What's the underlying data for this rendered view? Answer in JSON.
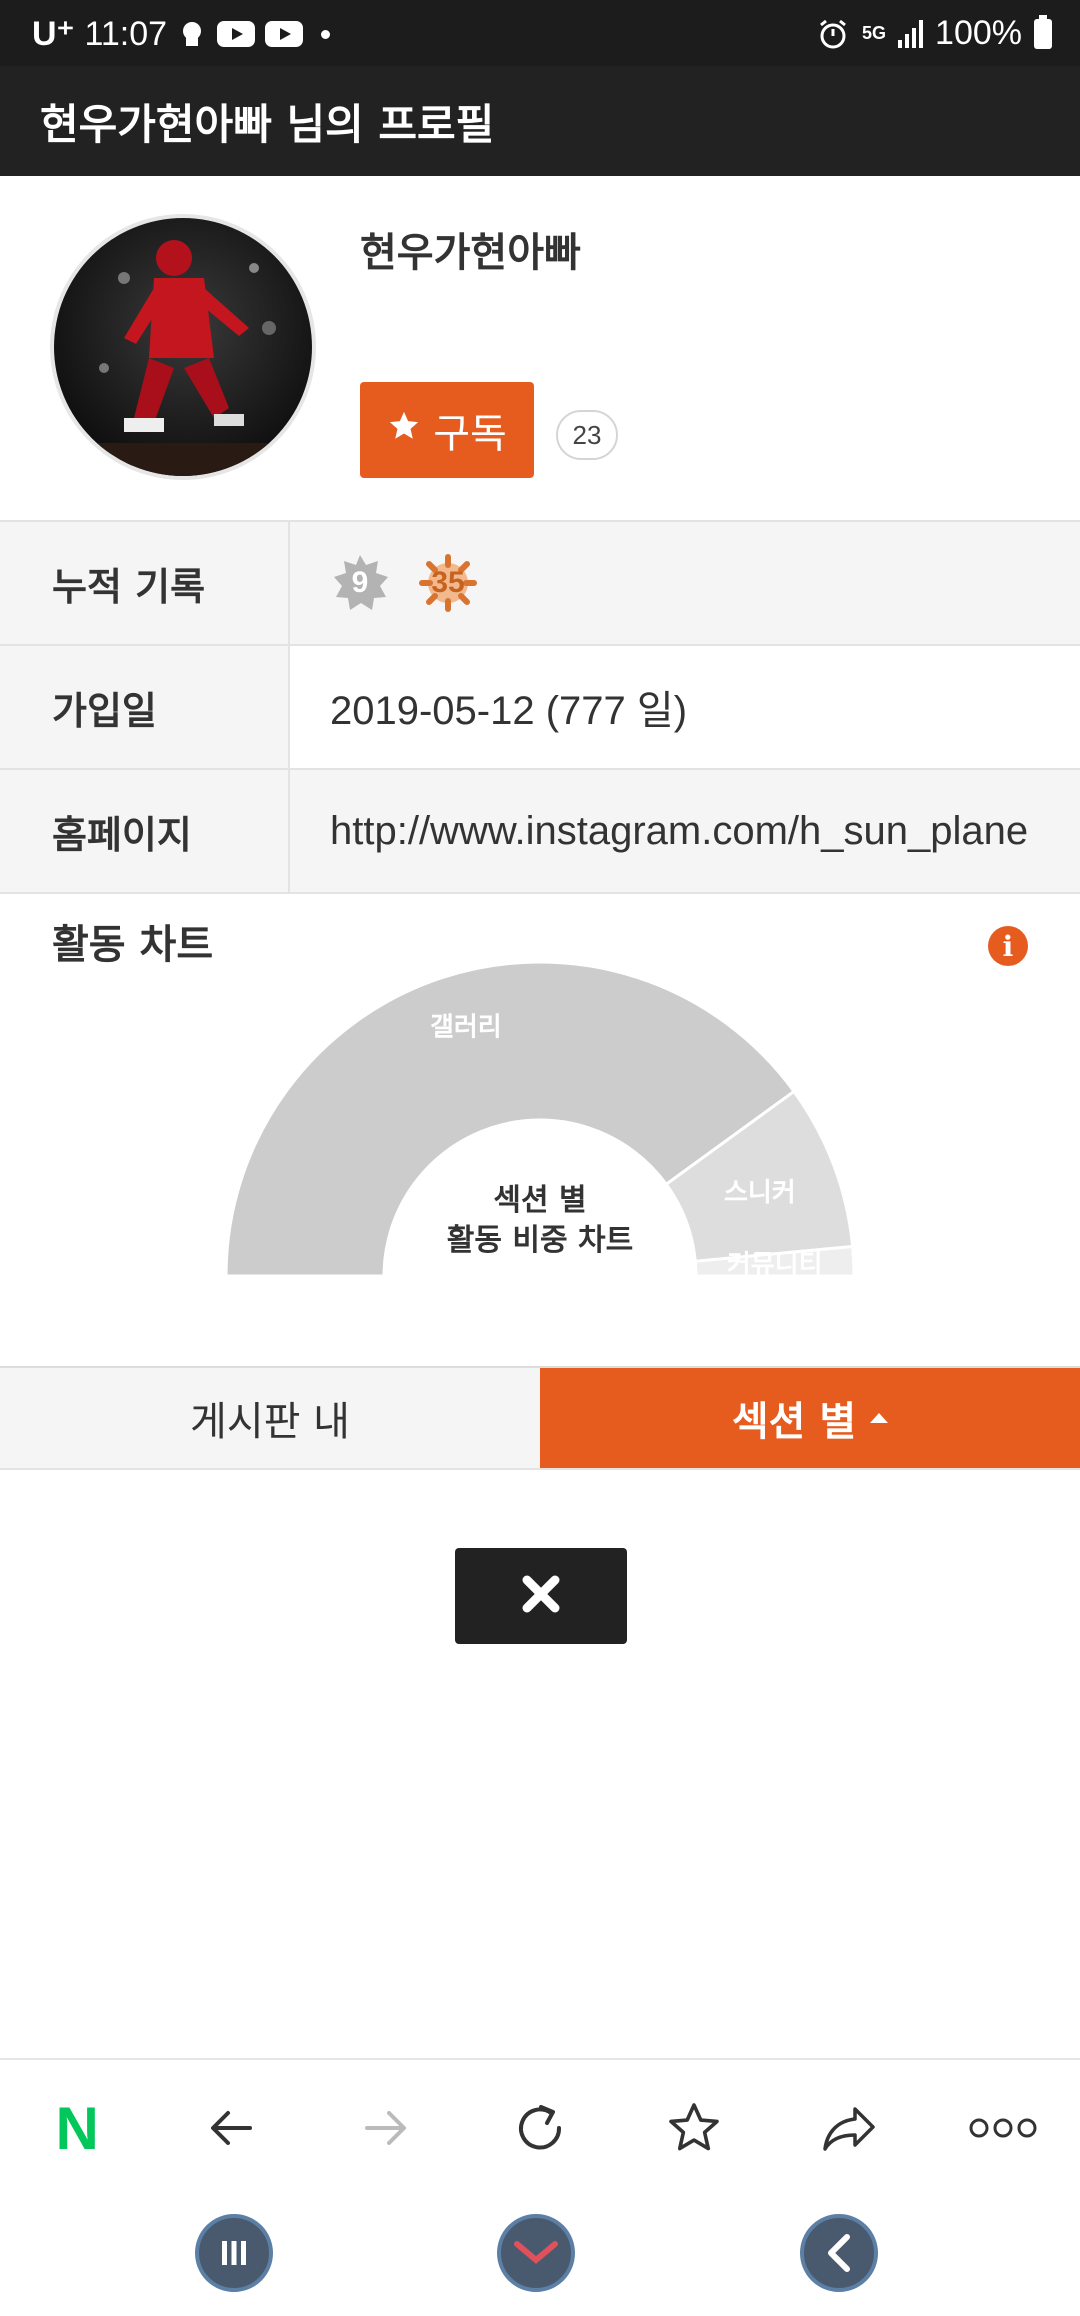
{
  "status_bar": {
    "carrier": "U⁺",
    "time": "11:07",
    "network": "5G",
    "battery": "100%"
  },
  "header": {
    "title": "현우가현아빠 님의 프로필"
  },
  "profile": {
    "nickname": "현우가현아빠",
    "subscribe_label": "구독",
    "subscriber_count": "23"
  },
  "info_rows": [
    {
      "label": "누적 기록",
      "badges": [
        "9",
        "35"
      ]
    },
    {
      "label": "가입일",
      "value": "2019-05-12 (777 일)"
    },
    {
      "label": "홈페이지",
      "value": "http://www.instagram.com/h_sun_plane"
    }
  ],
  "activity": {
    "title": "활동 차트",
    "center_line1": "섹션 별",
    "center_line2": "활동 비중 차트"
  },
  "chart_data": {
    "type": "pie",
    "categories": [
      "갤러리",
      "스니커",
      "커뮤니티"
    ],
    "values": [
      80,
      17,
      3
    ],
    "colors": [
      "#cccccc",
      "#dddddd",
      "#eeeeee"
    ]
  },
  "tabs": [
    {
      "label": "게시판 내",
      "active": false
    },
    {
      "label": "섹션 별",
      "active": true
    }
  ],
  "accent_color": "#e65c1f",
  "browser_toolbar": {
    "logo": "N",
    "icons": [
      "back-arrow-icon",
      "forward-arrow-icon",
      "refresh-icon",
      "star-icon",
      "share-icon",
      "more-icon"
    ]
  }
}
